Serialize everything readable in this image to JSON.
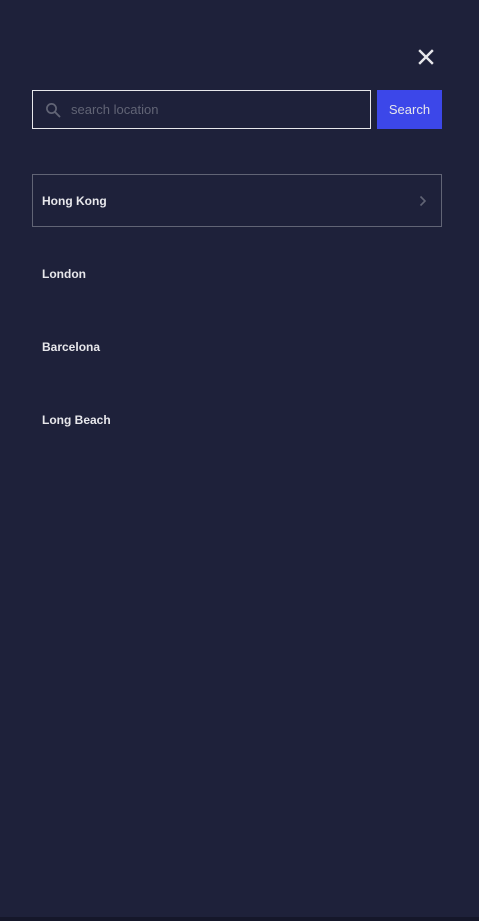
{
  "close": {
    "icon": "close-icon"
  },
  "search": {
    "placeholder": "search location",
    "value": "",
    "icon": "search-icon",
    "button_label": "Search"
  },
  "locations": [
    {
      "label": "Hong Kong",
      "selected": true,
      "icon": "chevron-right-icon"
    },
    {
      "label": "London",
      "selected": false
    },
    {
      "label": "Barcelona",
      "selected": false
    },
    {
      "label": "Long Beach",
      "selected": false
    }
  ],
  "colors": {
    "background": "#1e213a",
    "accent": "#3c47e9",
    "text": "#e7e7eb",
    "muted": "#616475"
  }
}
